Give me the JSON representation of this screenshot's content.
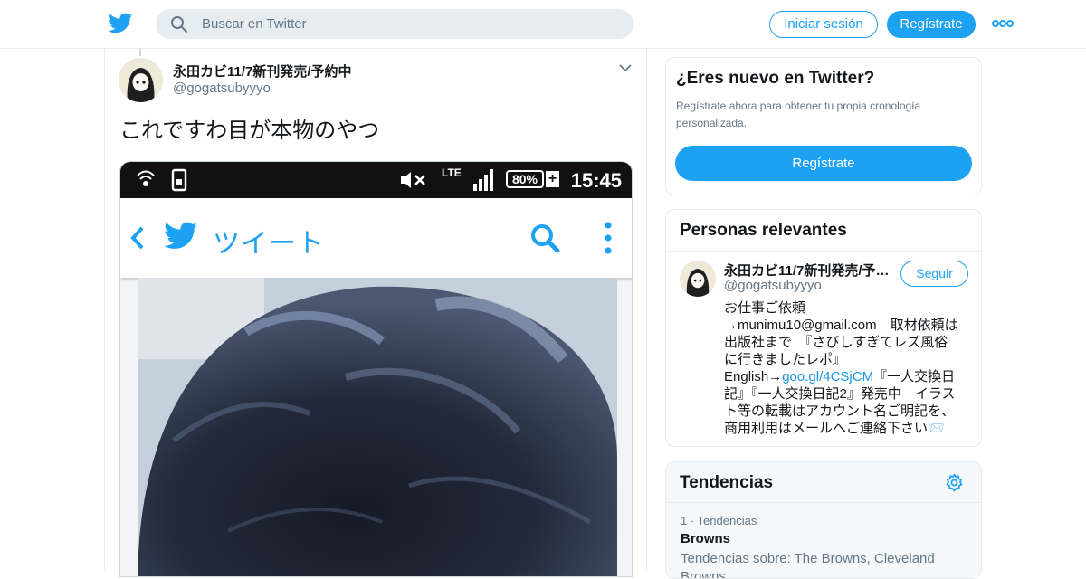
{
  "topbar": {
    "logo_icon": "twitter-bird-icon",
    "search_placeholder": "Buscar en Twitter",
    "login_label": "Iniciar sesión",
    "signup_label": "Regístrate",
    "more_icon": "more-dots-icon"
  },
  "tweet": {
    "author_name": "永田カビ11/7新刊発売/予約中",
    "author_handle": "@gogatsubyyyo",
    "text": "これですわ目が本物のやつ",
    "media": {
      "status_lte": "LTE",
      "status_battery": "80%",
      "status_plus": "+",
      "status_time": "15:45",
      "app_title": "ツイート"
    }
  },
  "new_to_twitter": {
    "title": "¿Eres nuevo en Twitter?",
    "subtitle": "Regístrate ahora para obtener tu propia cronología personalizada.",
    "button_label": "Regístrate"
  },
  "relevant_people": {
    "title": "Personas relevantes",
    "person": {
      "name": "永田カビ11/7新刊発売/予…",
      "handle": "@gogatsubyyyo",
      "follow_label": "Seguir",
      "bio_lines": [
        "お仕事ご依頼",
        "→munimu10@gmail.com　取材依頼は",
        "出版社まで　『さびしすぎてレズ風俗",
        "に行きましたレポ』"
      ],
      "bio_english_prefix": "English→",
      "bio_link": "goo.gl/4CSjCM",
      "bio_english_suffix": "『一人交換日",
      "bio_lines_after": [
        "記』『一人交換日記2』発売中　イラス",
        "ト等の転載はアカウント名ご明記を、",
        "商用利用はメールへご連絡下さい📨"
      ]
    }
  },
  "trends": {
    "title": "Tendencias",
    "settings_icon": "gear-icon",
    "items": [
      {
        "meta": "1 · Tendencias",
        "name": "Browns",
        "description": "Tendencias sobre: The Browns, Cleveland Browns"
      }
    ]
  },
  "colors": {
    "accent": "#1da1f2",
    "text": "#14171a",
    "muted": "#657786",
    "border": "#e6ecf0"
  }
}
